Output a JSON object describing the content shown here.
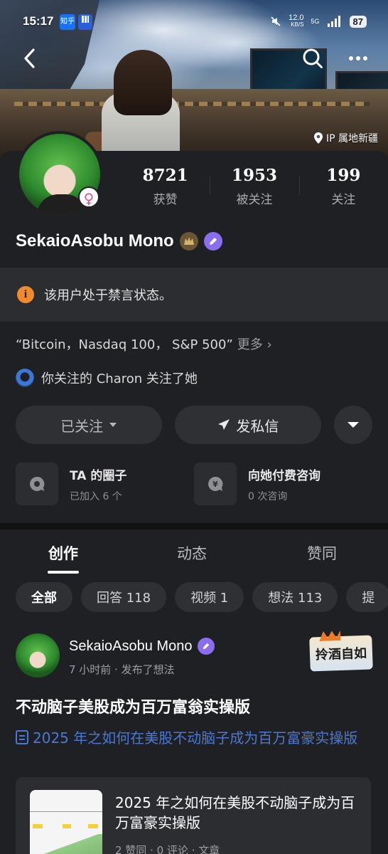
{
  "status_bar": {
    "time": "15:17",
    "app1": "知乎",
    "app2": "",
    "net_speed": "12.0",
    "net_unit": "KB/S",
    "network": "5G",
    "battery": "87"
  },
  "cover": {
    "ip_location": "IP 属地新疆"
  },
  "profile": {
    "stats": [
      {
        "value": "8721",
        "label": "获赞"
      },
      {
        "value": "1953",
        "label": "被关注"
      },
      {
        "value": "199",
        "label": "关注"
      }
    ],
    "username": "SekaioAsobu Mono",
    "ban_notice": "该用户处于禁言状态。",
    "bio": "“Bitcoin，Nasdaq 100， S&P 500”",
    "bio_more": "更多 ›",
    "mutual_follow": "你关注的 Charon 关注了她",
    "buttons": {
      "following": "已关注",
      "message": "发私信"
    },
    "services": [
      {
        "title": "TA 的圈子",
        "subtitle": "已加入 6 个"
      },
      {
        "title": "向她付费咨询",
        "subtitle": "0 次咨询"
      }
    ]
  },
  "content": {
    "tabs": [
      "创作",
      "动态",
      "赞同"
    ],
    "chips": [
      "全部",
      "回答 118",
      "视频 1",
      "想法 113",
      "提"
    ],
    "post": {
      "author": "SekaioAsobu Mono",
      "meta": "7 小时前 · 发布了想法",
      "sticker": "拎酒自如",
      "title": "不动脑子美股成为百万富翁实操版",
      "link_text": "2025 年之如何在美股不动脑子成为百万富豪实操版",
      "card_title": "2025 年之如何在美股不动脑子成为百万富豪实操版",
      "card_meta": "2 赞同 · 0 评论 · 文章"
    }
  },
  "colors": {
    "background": "#1f2023",
    "accent_link": "#4b78d6",
    "warning": "#f08a2c",
    "verified_purple": "#8b6df0",
    "female_pink": "#e25594"
  }
}
